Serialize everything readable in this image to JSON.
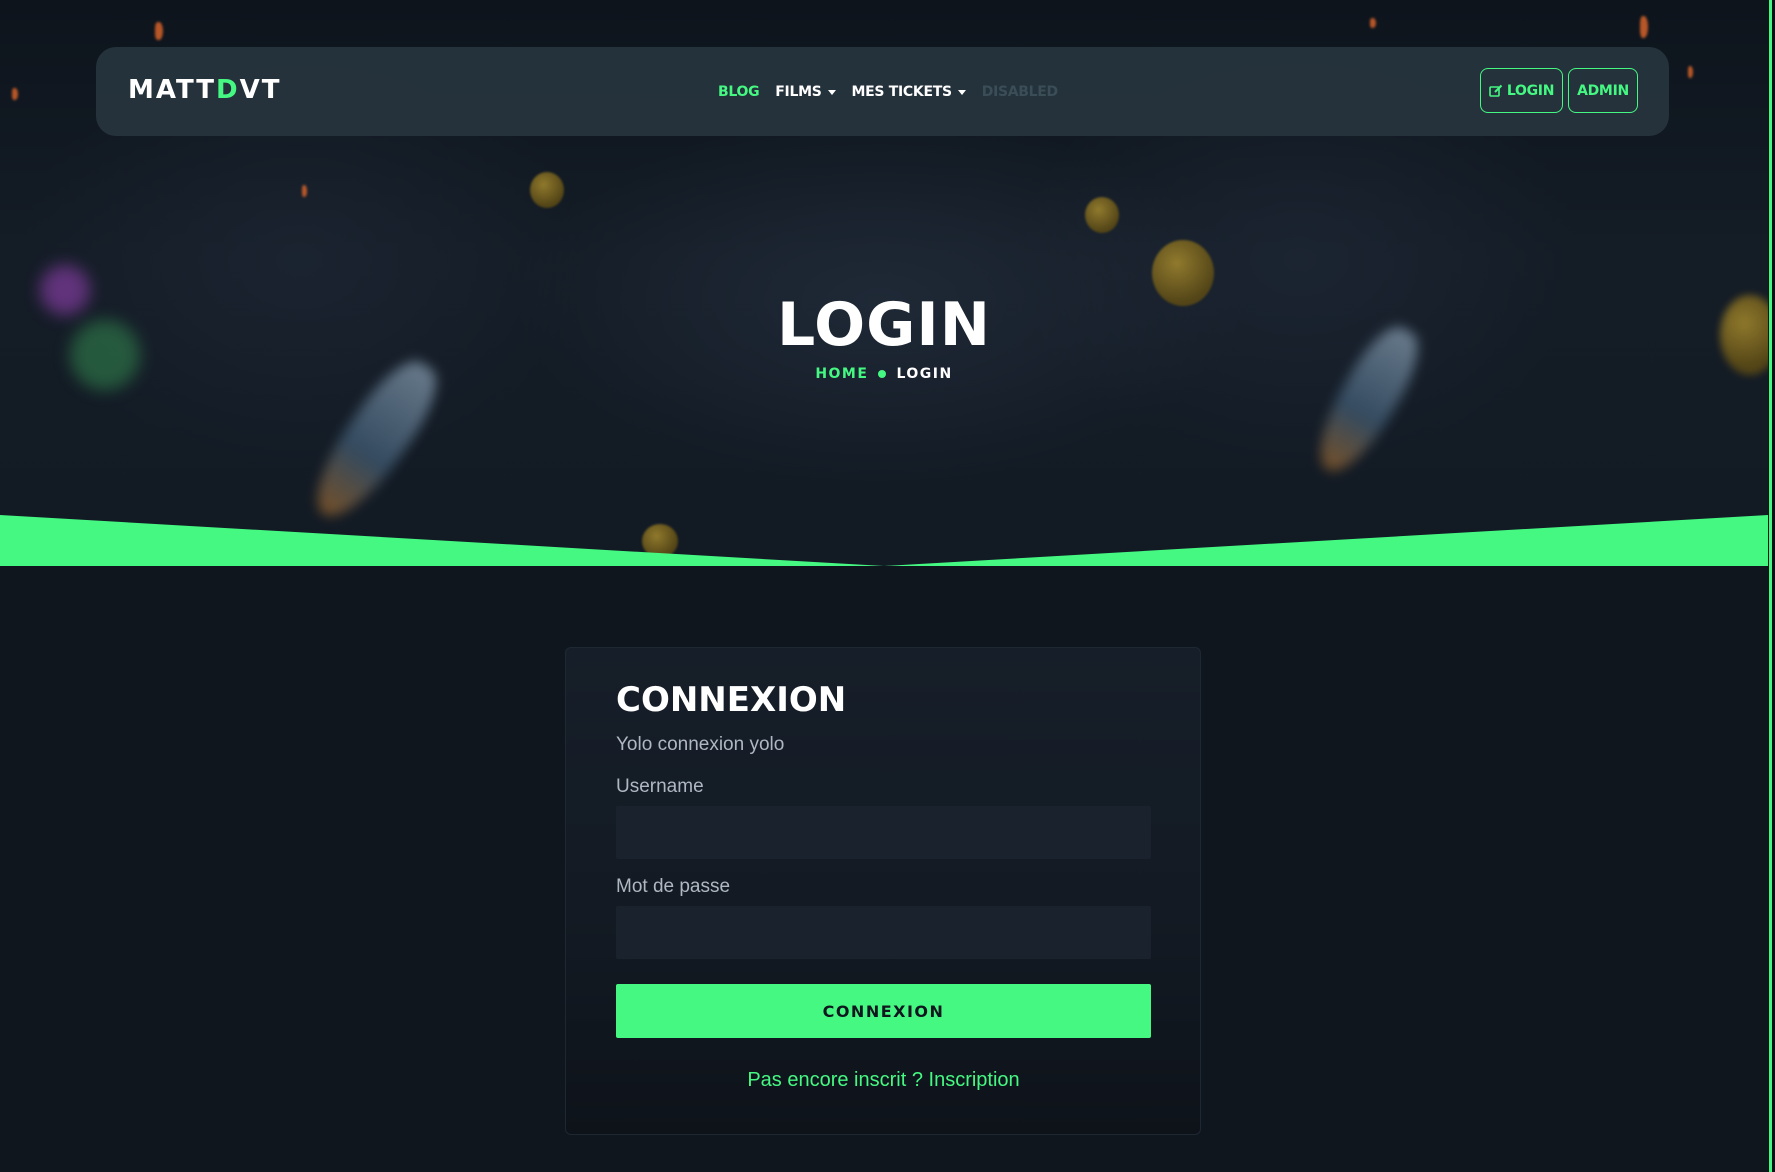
{
  "navbar": {
    "brand_part1": "MATT",
    "brand_accent": "D",
    "brand_part2": "VT",
    "links": [
      {
        "label": "BLOG",
        "state": "active"
      },
      {
        "label": "FILMS",
        "dropdown": true
      },
      {
        "label": "MES TICKETS",
        "dropdown": true
      },
      {
        "label": "DISABLED",
        "state": "disabled"
      }
    ],
    "login_button": {
      "label": "LOGIN",
      "icon": "edit-icon"
    },
    "admin_button": {
      "label": "ADMIN"
    }
  },
  "hero": {
    "title": "LOGIN",
    "breadcrumb": {
      "home": "HOME",
      "current": "LOGIN"
    }
  },
  "login_card": {
    "title": "CONNEXION",
    "subtitle": "Yolo connexion yolo",
    "username_label": "Username",
    "username_value": "",
    "password_label": "Mot de passe",
    "password_value": "",
    "submit_label": "CONNEXION",
    "register_link": "Pas encore inscrit ? Inscription"
  },
  "colors": {
    "accent": "#45f882",
    "background": "#0f161e",
    "navbar": "#26343e",
    "card": "#161e29",
    "input": "#1a222d"
  }
}
